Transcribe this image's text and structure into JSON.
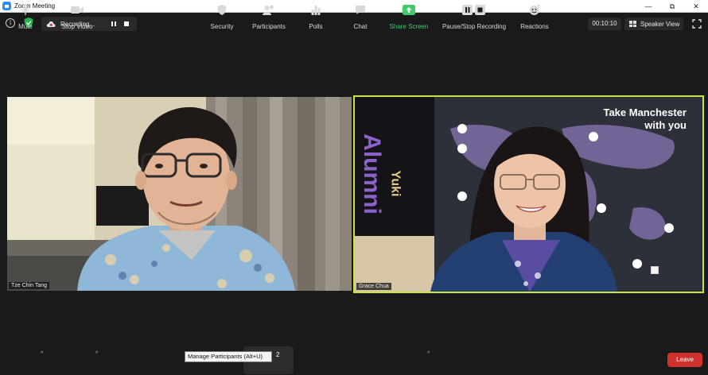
{
  "window": {
    "title": "Zoom Meeting",
    "minimize": "—",
    "restore": "⧉",
    "close": "✕"
  },
  "topbar": {
    "recording_label": "Recording...",
    "timer": "00:10:10",
    "view_label": "Speaker View"
  },
  "participants": [
    {
      "name": "Tze Chin Tang"
    },
    {
      "name": "Grace Chua"
    }
  ],
  "backdrop": {
    "logo_text": "Alumni",
    "logo_sub": "Yuki",
    "tagline_line1": "Take Manchester",
    "tagline_line2": "with you"
  },
  "toolbar": {
    "mute": "Mute",
    "stop_video": "Stop Video",
    "security": "Security",
    "participants": "Participants",
    "participants_count": "2",
    "polls": "Polls",
    "chat": "Chat",
    "share_screen": "Share Screen",
    "recording": "Pause/Stop Recording",
    "reactions": "Reactions",
    "leave": "Leave",
    "tooltip": "Manage Participants (Alt+U)"
  },
  "colors": {
    "active_speaker_border": "#c9e244",
    "share_green": "#42c96b",
    "leave_red": "#d0312d",
    "zoom_blue": "#2d8cff"
  }
}
